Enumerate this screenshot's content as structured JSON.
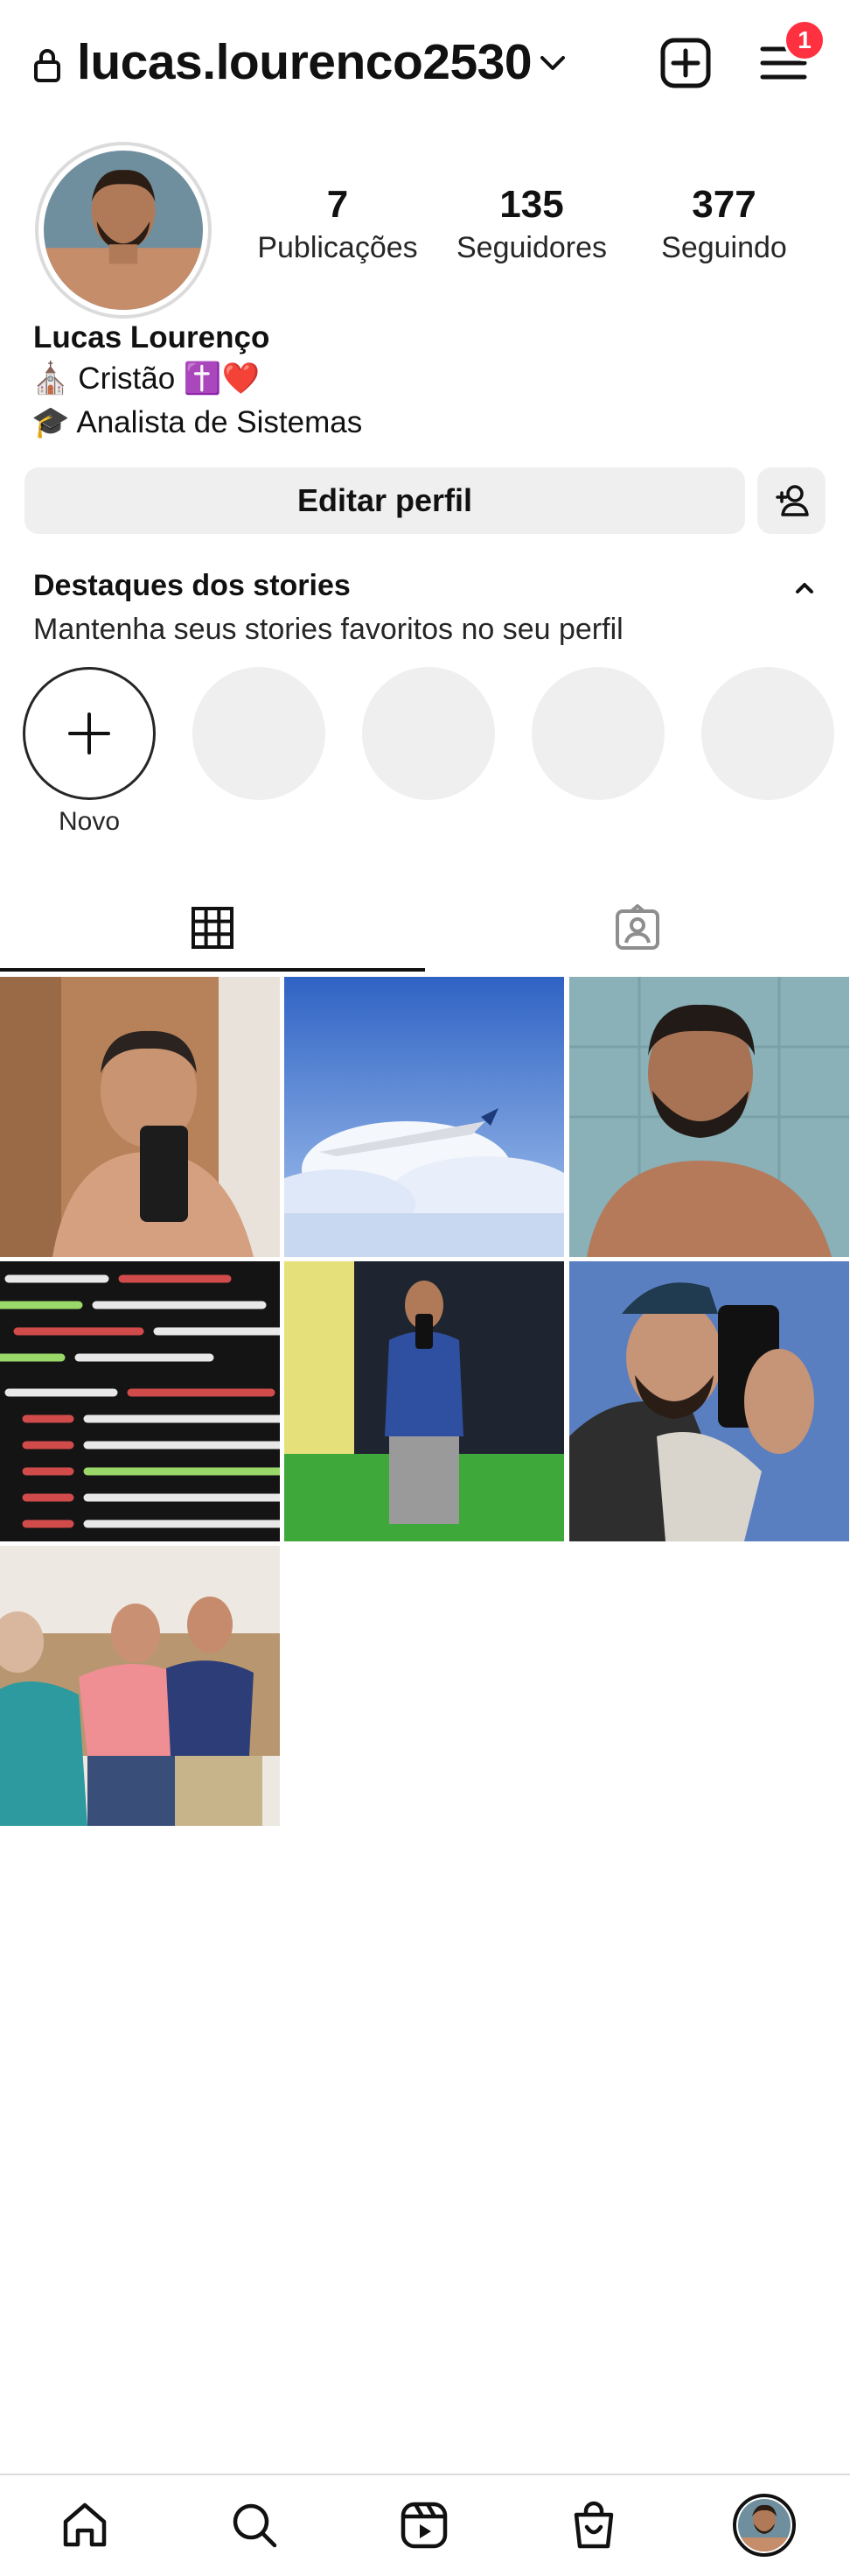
{
  "header": {
    "username": "lucas.lourenco2530",
    "notification_count": "1"
  },
  "profile": {
    "stats": [
      {
        "value": "7",
        "label": "Publicações"
      },
      {
        "value": "135",
        "label": "Seguidores"
      },
      {
        "value": "377",
        "label": "Seguindo"
      }
    ],
    "name": "Lucas Lourenço",
    "bio_lines": [
      "⛪ Cristão ✝️❤️",
      "🎓 Analista de Sistemas"
    ]
  },
  "actions": {
    "edit_profile": "Editar perfil"
  },
  "highlights": {
    "title": "Destaques dos stories",
    "subtitle": "Mantenha seus stories favoritos no seu perfil",
    "new_label": "Novo"
  },
  "tabs": [
    {
      "icon": "grid-icon",
      "active": true
    },
    {
      "icon": "tagged-icon",
      "active": false
    }
  ],
  "posts": [
    {
      "desc": "selfie-mirror",
      "accent": "#b7825a"
    },
    {
      "desc": "airplane-clouds",
      "accent": "#4a79c9"
    },
    {
      "desc": "selfie-tile-wall",
      "accent": "#8ab0b8"
    },
    {
      "desc": "code-screen",
      "accent": "#1a1a1a"
    },
    {
      "desc": "gym-mirror",
      "accent": "#2f4fa0"
    },
    {
      "desc": "selfie-cap",
      "accent": "#3a3a3a"
    },
    {
      "desc": "family-sofa",
      "accent": "#e59a9a"
    }
  ],
  "bottom_nav": [
    "home-icon",
    "search-icon",
    "reels-icon",
    "shop-icon",
    "profile-avatar"
  ],
  "colors": {
    "badge": "#ff3040",
    "button_bg": "#efefef",
    "divider": "#dbdbdb"
  }
}
